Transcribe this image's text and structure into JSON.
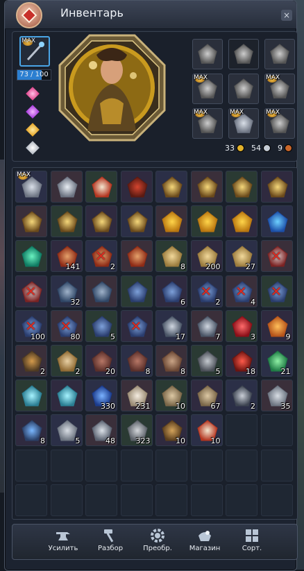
{
  "window": {
    "title": "Инвентарь",
    "close": "×"
  },
  "character": {
    "weapon": {
      "badge": "MAX",
      "durability_text": "73 / 100",
      "durability": 0.73
    },
    "gems": [
      "pink",
      "purple",
      "gold",
      "white"
    ],
    "equipment": [
      {
        "icon": "chest-armor-icon",
        "badge": ""
      },
      {
        "icon": "belt-icon",
        "badge": "",
        "dim": true
      },
      {
        "icon": "boots-icon",
        "badge": ""
      },
      {
        "icon": "earring-icon",
        "badge": "MAX"
      },
      {
        "icon": "necklace-icon",
        "badge": ""
      },
      {
        "icon": "bracelet-icon",
        "badge": "MAX"
      },
      {
        "icon": "earring-2-icon",
        "badge": "MAX"
      },
      {
        "icon": "ring-icon",
        "badge": "MAX"
      },
      {
        "icon": "ring-2-icon",
        "badge": "MAX"
      }
    ],
    "currency": {
      "gold": "33",
      "silver": "54",
      "copper": "9"
    }
  },
  "inventory": {
    "rows": [
      [
        {
          "icon": "ring-icon",
          "badge": "MAX"
        },
        {
          "icon": "silver-ring-icon"
        },
        {
          "icon": "talisman-icon"
        },
        {
          "icon": "red-armor-icon"
        },
        {
          "icon": "crystal-shard-icon"
        },
        {
          "icon": "crystal-shard-icon"
        },
        {
          "icon": "crystal-shard-icon"
        },
        {
          "icon": "crystal-shard-icon"
        }
      ],
      [
        {
          "icon": "crystal-shard-icon"
        },
        {
          "icon": "crystal-shard-icon"
        },
        {
          "icon": "crystal-shard-icon"
        },
        {
          "icon": "crystal-shard-icon"
        },
        {
          "icon": "gold-crystal-icon"
        },
        {
          "icon": "gold-crystal-icon"
        },
        {
          "icon": "gold-crystal-icon"
        },
        {
          "icon": "blue-crystal-icon"
        }
      ],
      [
        {
          "icon": "green-gem-icon"
        },
        {
          "icon": "potion-icon",
          "count": "141"
        },
        {
          "icon": "potion-icon",
          "count": "2",
          "blocked": true
        },
        {
          "icon": "potion-icon"
        },
        {
          "icon": "gold-ore-icon",
          "count": "8"
        },
        {
          "icon": "gold-ore-icon",
          "count": "200"
        },
        {
          "icon": "gold-ore-icon",
          "count": "27"
        },
        {
          "icon": "vial-icon",
          "blocked": true
        }
      ],
      [
        {
          "icon": "vial-icon",
          "blocked": true
        },
        {
          "icon": "hammer-icon",
          "count": "32"
        },
        {
          "icon": "hammer-icon"
        },
        {
          "icon": "scroll-icon"
        },
        {
          "icon": "scroll-icon",
          "count": "6"
        },
        {
          "icon": "scroll-icon",
          "count": "2",
          "blocked": true
        },
        {
          "icon": "scroll-icon",
          "count": "4",
          "blocked": true
        },
        {
          "icon": "scroll-icon",
          "blocked": true
        }
      ],
      [
        {
          "icon": "scroll-icon",
          "count": "100",
          "blocked": true
        },
        {
          "icon": "scroll-icon",
          "count": "80",
          "blocked": true
        },
        {
          "icon": "scroll-icon",
          "count": "5"
        },
        {
          "icon": "scroll-icon",
          "blocked": true
        },
        {
          "icon": "key-icon",
          "count": "17"
        },
        {
          "icon": "key-icon",
          "count": "7"
        },
        {
          "icon": "red-gem-icon",
          "count": "3"
        },
        {
          "icon": "orange-gem-icon",
          "count": "9"
        }
      ],
      [
        {
          "icon": "pickaxe-icon",
          "count": "2"
        },
        {
          "icon": "pouch-icon",
          "count": "2"
        },
        {
          "icon": "stick-icon",
          "count": "20"
        },
        {
          "icon": "stick-icon",
          "count": "8"
        },
        {
          "icon": "shell-icon",
          "count": "8"
        },
        {
          "icon": "crown-icon",
          "count": "5"
        },
        {
          "icon": "lantern-icon",
          "count": "18"
        },
        {
          "icon": "green-crystal-icon",
          "count": "21"
        }
      ],
      [
        {
          "icon": "ice-gem-icon"
        },
        {
          "icon": "ice-gem-icon"
        },
        {
          "icon": "powder-icon",
          "count": "330"
        },
        {
          "icon": "paper-scroll-icon",
          "count": "231"
        },
        {
          "icon": "map-icon",
          "count": "10"
        },
        {
          "icon": "map-icon",
          "count": "67"
        },
        {
          "icon": "cube-icon",
          "count": "2"
        },
        {
          "icon": "coin-icon",
          "count": "35"
        }
      ],
      [
        {
          "icon": "blue-shard-icon",
          "count": "8"
        },
        {
          "icon": "coin-icon",
          "count": "5"
        },
        {
          "icon": "medal-icon",
          "count": "48"
        },
        {
          "icon": "box-icon",
          "count": "323"
        },
        {
          "icon": "chest-icon",
          "count": "10"
        },
        {
          "icon": "talisman-icon",
          "count": "10"
        },
        {
          "empty": true
        },
        {
          "empty": true
        }
      ],
      [
        {
          "empty": true
        },
        {
          "empty": true
        },
        {
          "empty": true
        },
        {
          "empty": true
        },
        {
          "empty": true
        },
        {
          "empty": true
        },
        {
          "empty": true
        },
        {
          "empty": true
        }
      ],
      [
        {
          "empty": true
        },
        {
          "empty": true
        },
        {
          "empty": true
        },
        {
          "empty": true
        },
        {
          "empty": true
        },
        {
          "empty": true
        },
        {
          "empty": true
        },
        {
          "empty": true
        }
      ]
    ]
  },
  "toolbar": {
    "enhance": "Усилить",
    "dismantle": "Разбор",
    "transform": "Преобр.",
    "shop": "Магазин",
    "sort": "Сорт."
  }
}
